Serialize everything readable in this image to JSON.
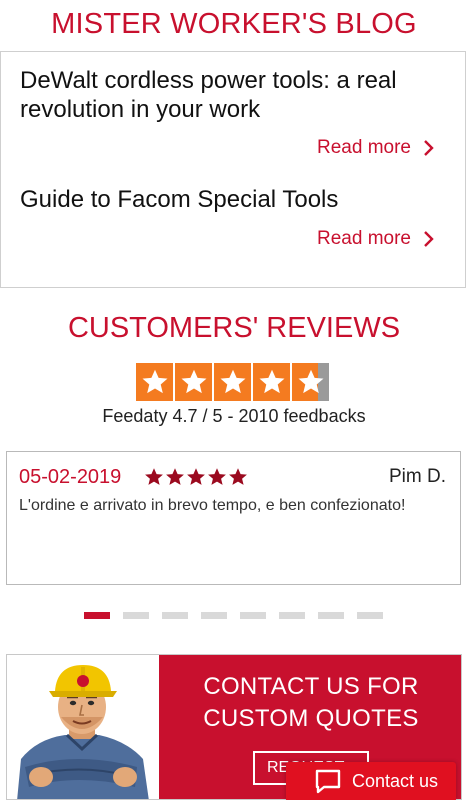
{
  "blog": {
    "title": "MISTER WORKER'S BLOG",
    "posts": [
      {
        "title": "DeWalt cordless power tools: a real revolution in your work",
        "cta": "Read more"
      },
      {
        "title": "Guide to Facom Special Tools",
        "cta": "Read more"
      }
    ]
  },
  "reviews": {
    "title": "CUSTOMERS' REVIEWS",
    "rating": 4.7,
    "rating_max": 5,
    "summary": "Feedaty 4.7 / 5 - 2010 feedbacks",
    "items": [
      {
        "date": "05-02-2019",
        "stars": 5,
        "author": "Pim D.",
        "text": "L'ordine e arrivato in brevo tempo, e ben confezionato!"
      }
    ],
    "carousel": {
      "count": 8,
      "active_index": 0
    }
  },
  "contact": {
    "heading_line1": "CONTACT US FOR",
    "heading_line2": "CUSTOM QUOTES",
    "button_label": "REQUEST"
  },
  "chat": {
    "label": "Contact us"
  },
  "colors": {
    "brand_red": "#c8102e",
    "feedaty_orange": "#f47b20",
    "chat_red": "#e01020"
  }
}
